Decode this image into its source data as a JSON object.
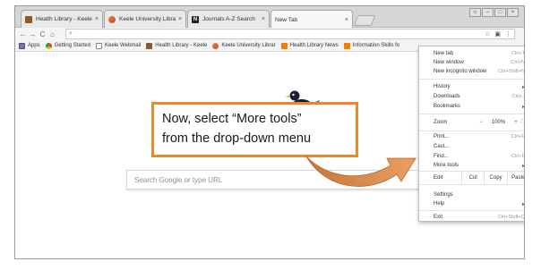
{
  "colors": {
    "accent": "#e8882d",
    "callout_text": "#1a1a1a",
    "tab_strip": "#d6d6d6",
    "active_tab": "#f7f7f7"
  },
  "tabs": [
    {
      "label": "Health Library - Keele Ur",
      "favicon": "library-icon",
      "active": false
    },
    {
      "label": "Keele University Library",
      "favicon": "keele-icon",
      "active": false
    },
    {
      "label": "Journals A-Z Search",
      "favicon": "n-letter-icon",
      "active": false
    },
    {
      "label": "New Tab",
      "favicon": "none",
      "active": true
    }
  ],
  "tab_close_glyph": "×",
  "toolbar": {
    "back": "←",
    "forward": "→",
    "reload": "C",
    "home": "⌂",
    "star": "☆",
    "menu_glyph": "⋮"
  },
  "bookmarks": [
    {
      "label": "Apps",
      "icon": "apps-grid-icon"
    },
    {
      "label": "Getting Started",
      "icon": "chrome-icon"
    },
    {
      "label": "Keele Webmail",
      "icon": "page-icon"
    },
    {
      "label": "Health Library - Keele",
      "icon": "library-icon"
    },
    {
      "label": "Keele University Librar",
      "icon": "keele-icon"
    },
    {
      "label": "Health Library News",
      "icon": "blogger-icon"
    },
    {
      "label": "Information Skills fo",
      "icon": "blogger-icon"
    }
  ],
  "search": {
    "placeholder": "Search Google or type URL"
  },
  "menu": {
    "new_tab": {
      "label": "New tab",
      "shortcut": "Ctrl+T"
    },
    "new_window": {
      "label": "New window",
      "shortcut": "Ctrl+N"
    },
    "new_incognito": {
      "label": "New incognito window",
      "shortcut": "Ctrl+Shift+N"
    },
    "history": {
      "label": "History"
    },
    "downloads": {
      "label": "Downloads",
      "shortcut": "Ctrl+J"
    },
    "bookmarks": {
      "label": "Bookmarks"
    },
    "zoom": {
      "label": "Zoom",
      "minus": "−",
      "value": "100%",
      "plus": "+",
      "fullscreen": "⛶"
    },
    "print": {
      "label": "Print...",
      "shortcut": "Ctrl+P"
    },
    "cast": {
      "label": "Cast..."
    },
    "find": {
      "label": "Find...",
      "shortcut": "Ctrl+F"
    },
    "more_tools": {
      "label": "More tools"
    },
    "edit": {
      "label": "Edit",
      "cut": "Cut",
      "copy": "Copy",
      "paste": "Paste"
    },
    "settings": {
      "label": "Settings"
    },
    "help": {
      "label": "Help"
    },
    "exit": {
      "label": "Exit",
      "shortcut": "Ctrl+Shift+Q"
    },
    "submenu_arrow": "▸"
  },
  "callout": {
    "line1": "Now, select “More tools”",
    "line2": "from the drop-down menu"
  }
}
